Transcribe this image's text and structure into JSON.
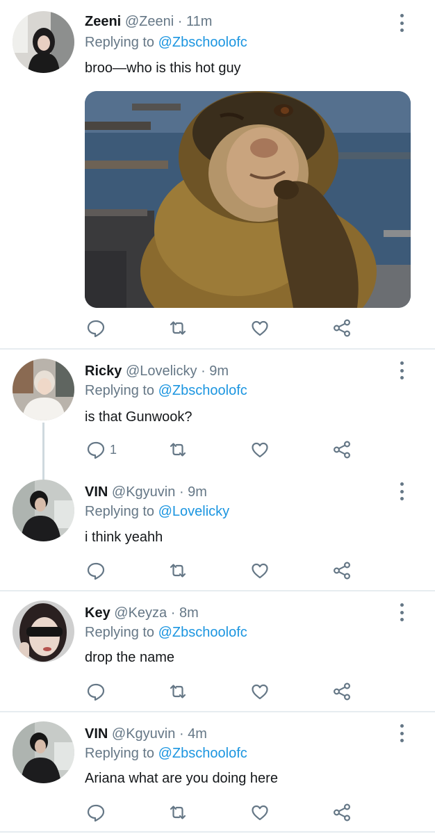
{
  "colors": {
    "text": "#14171a",
    "secondary": "#657786",
    "link": "#1b95e0",
    "divider": "#e6ecf0"
  },
  "icons": [
    "reply-icon",
    "retweet-icon",
    "like-icon",
    "share-icon",
    "more-icon"
  ],
  "tweets": [
    {
      "name": "Zeeni",
      "handle": "@Zeeni",
      "separator": "·",
      "time": "11m",
      "replying_prefix": "Replying to",
      "replying_to": "@Zbschoolofc",
      "text": "broo—who is this hot guy",
      "reply_count": ""
    },
    {
      "name": "Ricky",
      "handle": "@Lovelicky",
      "separator": "·",
      "time": "9m",
      "replying_prefix": "Replying to",
      "replying_to": "@Zbschoolofc",
      "text": "is that Gunwook?",
      "reply_count": "1"
    },
    {
      "name": "VIN",
      "handle": "@Kgyuvin",
      "separator": "·",
      "time": "9m",
      "replying_prefix": "Replying to",
      "replying_to": "@Lovelicky",
      "text": "i think yeahh",
      "reply_count": ""
    },
    {
      "name": "Key",
      "handle": "@Keyza",
      "separator": "·",
      "time": "8m",
      "replying_prefix": "Replying to",
      "replying_to": "@Zbschoolofc",
      "text": "drop the name",
      "reply_count": ""
    },
    {
      "name": "VIN",
      "handle": "@Kgyuvin",
      "separator": "·",
      "time": "4m",
      "replying_prefix": "Replying to",
      "replying_to": "@Zbschoolofc",
      "text": "Ariana what are you doing here",
      "reply_count": ""
    }
  ]
}
